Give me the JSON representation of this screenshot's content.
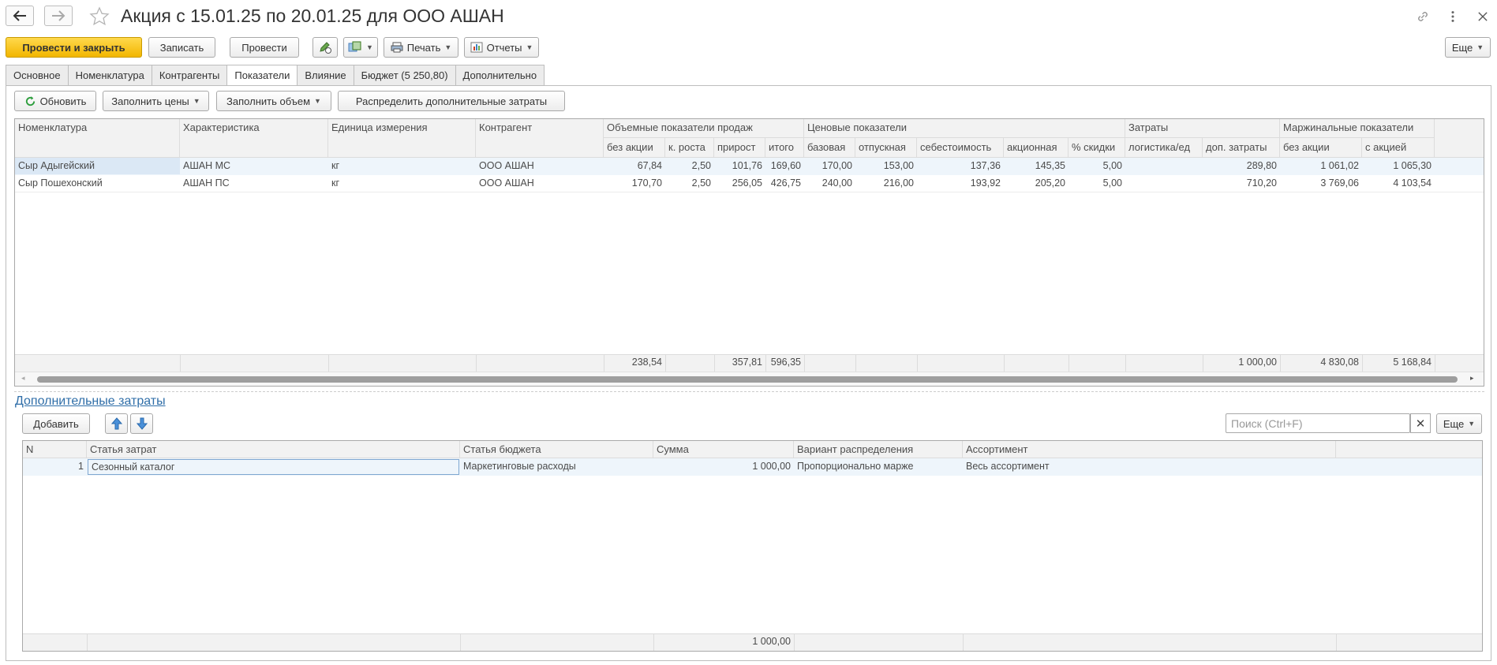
{
  "window": {
    "title": "Акция с 15.01.25 по 20.01.25 для ООО АШАН"
  },
  "toolbar": {
    "post_close": "Провести и закрыть",
    "save": "Записать",
    "post": "Провести",
    "print": "Печать",
    "reports": "Отчеты",
    "more": "Еще"
  },
  "tabs": [
    {
      "label": "Основное"
    },
    {
      "label": "Номенклатура"
    },
    {
      "label": "Контрагенты"
    },
    {
      "label": "Показатели",
      "active": true
    },
    {
      "label": "Влияние"
    },
    {
      "label": "Бюджет (5 250,80)"
    },
    {
      "label": "Дополнительно"
    }
  ],
  "indicators": {
    "toolbar": {
      "refresh": "Обновить",
      "fill_prices": "Заполнить цены",
      "fill_volume": "Заполнить объем",
      "distribute": "Распределить дополнительные затраты"
    },
    "headers": {
      "nomenclature": "Номенклатура",
      "characteristic": "Характеристика",
      "unit": "Единица измерения",
      "counterparty": "Контрагент",
      "volume_group": "Объемные показатели продаж",
      "price_group": "Ценовые показатели",
      "cost_group": "Затраты",
      "margin_group": "Маржинальные показатели",
      "no_promo": "без акции",
      "growth_k": "к. роста",
      "increase": "прирост",
      "total": "итого",
      "base": "базовая",
      "release": "отпускная",
      "cost": "себестоимость",
      "promo": "акционная",
      "discount": "% скидки",
      "logistics": "логистика/ед",
      "extra_costs": "доп. затраты",
      "margin_no_promo": "без акции",
      "margin_promo": "с акцией"
    },
    "rows": [
      {
        "nomenclature": "Сыр Адыгейский",
        "characteristic": "АШАН МС",
        "unit": "кг",
        "counterparty": "ООО АШАН",
        "no_promo": "67,84",
        "growth_k": "2,50",
        "increase": "101,76",
        "total": "169,60",
        "base": "170,00",
        "release": "153,00",
        "cost": "137,36",
        "promo": "145,35",
        "discount": "5,00",
        "logistics": "",
        "extra_costs": "289,80",
        "margin_no_promo": "1 061,02",
        "margin_promo": "1 065,30"
      },
      {
        "nomenclature": "Сыр Пошехонский",
        "characteristic": "АШАН ПС",
        "unit": "кг",
        "counterparty": "ООО АШАН",
        "no_promo": "170,70",
        "growth_k": "2,50",
        "increase": "256,05",
        "total": "426,75",
        "base": "240,00",
        "release": "216,00",
        "cost": "193,92",
        "promo": "205,20",
        "discount": "5,00",
        "logistics": "",
        "extra_costs": "710,20",
        "margin_no_promo": "3 769,06",
        "margin_promo": "4 103,54"
      }
    ],
    "totals": {
      "no_promo": "238,54",
      "increase": "357,81",
      "total": "596,35",
      "extra_costs": "1 000,00",
      "margin_no_promo": "4 830,08",
      "margin_promo": "5 168,84"
    }
  },
  "extra_costs": {
    "link": "Дополнительные затраты",
    "add": "Добавить",
    "search_placeholder": "Поиск (Ctrl+F)",
    "more": "Еще",
    "headers": {
      "n": "N",
      "cost_item": "Статья затрат",
      "budget_item": "Статья бюджета",
      "amount": "Сумма",
      "distribution": "Вариант распределения",
      "assortment": "Ассортимент"
    },
    "rows": [
      {
        "n": "1",
        "cost_item": "Сезонный каталог",
        "budget_item": "Маркетинговые расходы",
        "amount": "1 000,00",
        "distribution": "Пропорционально марже",
        "assortment": "Весь ассортимент"
      }
    ],
    "total_amount": "1 000,00"
  },
  "colors": {
    "primary_button": "#f2b600",
    "link": "#2f6ea8",
    "selected_row": "#eef5fb",
    "header_bg": "#f2f2f2"
  }
}
